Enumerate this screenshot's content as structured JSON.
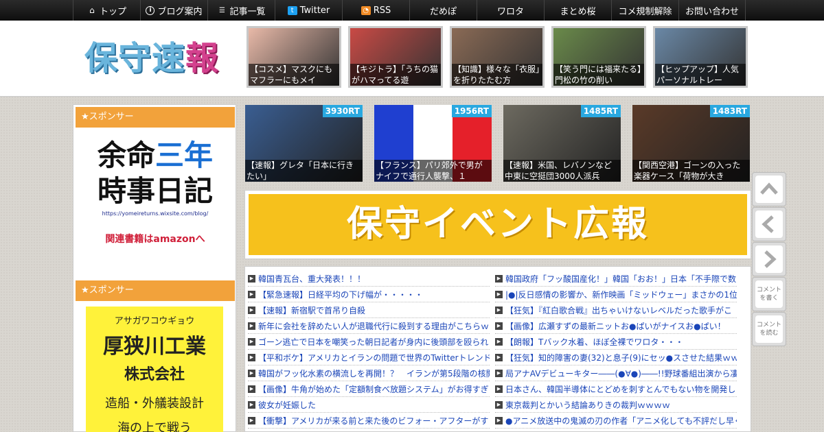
{
  "nav": {
    "items": [
      {
        "label": "トップ",
        "icon": "home-icon"
      },
      {
        "label": "ブログ案内",
        "icon": "info-icon"
      },
      {
        "label": "記事一覧",
        "icon": "list-icon"
      },
      {
        "label": "Twitter",
        "icon": "twitter-icon"
      },
      {
        "label": "RSS",
        "icon": "rss-icon"
      },
      {
        "label": "だめぽ",
        "icon": ""
      },
      {
        "label": "ワロタ",
        "icon": ""
      },
      {
        "label": "まとめ桜",
        "icon": ""
      },
      {
        "label": "コメ規制解除",
        "icon": ""
      },
      {
        "label": "お問い合わせ",
        "icon": ""
      }
    ]
  },
  "header": {
    "logo_part1": "保守",
    "logo_part2": "速",
    "logo_part3": "報",
    "thumbs": [
      {
        "caption": "【コスメ】マスクにもマフラーにもメイ",
        "color": "#e8b9a8"
      },
      {
        "caption": "【キジトラ】「うちの猫がハマってる遊",
        "color": "#c94a45"
      },
      {
        "caption": "【知識】様々な「衣服」を折りたたむ方",
        "color": "#8a6a55"
      },
      {
        "caption": "【笑う門には福来たる】門松の竹の削い",
        "color": "#6a8a4a"
      },
      {
        "caption": "【ヒップアップ】人気パーソナルトレー",
        "color": "#6a88a6"
      }
    ]
  },
  "sidebar": {
    "sponsor1_heading": "★スポンサー",
    "sponsor1_line1a": "余命",
    "sponsor1_line1b": "三年",
    "sponsor1_line2": "時事日記",
    "sponsor1_url": "https://yomeireturns.wixsite.com/blog/",
    "sponsor1_link": "関連書籍はamazonへ",
    "sponsor2_heading": "★スポンサー",
    "sponsor2_kana": "アサガワコウギョウ",
    "sponsor2_name": "厚狭川工業",
    "sponsor2_corp": "株式会社",
    "sponsor2_desc": "造船・外艤装設計",
    "sponsor2_more": "海の上で戦う"
  },
  "rt_row": [
    {
      "count": "3930RT",
      "caption": "【速報】グレタ「日本に行きたい」",
      "color": "#3a5e92"
    },
    {
      "count": "1956RT",
      "caption": "【フランス】パリ郊外で男がナイフで通行人襲撃、１",
      "color": "flag"
    },
    {
      "count": "1485RT",
      "caption": "【速報】米国、レバノンなど中東に空挺団3000人派兵",
      "color": "#6d6a60"
    },
    {
      "count": "1483RT",
      "caption": "【関西空港】ゴーンの入った楽器ケース「荷物が大き",
      "color": "#5a3a28"
    }
  ],
  "banner": {
    "text": "保守イベント広報"
  },
  "news_left": [
    "韓国青瓦台、重大発表！！！",
    "【緊急速報】日経平均の下げ幅が・・・・・",
    "【速報】新宿駅で首吊り自殺",
    "新年に会社を辞めたい人が退職代行に殺到する理由がこちらｗ",
    "ゴーン逃亡で日本を嘲笑った朝日記者が身内に後頭部を殴られ",
    "【平和ボケ】アメリカとイランの問題で世界のTwitterトレンド",
    "韓国がフッ化水素の横流しを再開！？　イランが第5段階の核開",
    "【画像】牛角が始めた「定額制食べ放題システム」がお得すぎ",
    "彼女が妊娠した",
    "【衝撃】アメリカが来る前と来た後のビフォー・アフターがす"
  ],
  "news_right": [
    "韓国政府「フッ酸国産化！」韓国「おお！」日本「不手際で数",
    "|●|反日感情の影響か、新作映画「ミッドウェー」まさかの1位",
    "【狂気】『紅白歌合戦』出ちゃいけないレベルだった歌手がこ",
    "【画像】広瀬すずの最新ニットお●ぱいがナイスお●ぱい！",
    "【朗報】Tバック水着、ほぼ全裸でワロタ・・・",
    "【狂気】知的障害の妻(32)と息子(9)にセッ●スさせた結果ｗｗｗ",
    "局アナAVデビューキター――(●∀●)――!!野球番組出演から凄まじ",
    "日本さん、韓国半導体にとどめを刺すとんでもない物を開発し",
    "東京裁判とかいう結論ありきの裁判ｗｗｗｗ",
    "●アニメ放送中の鬼滅の刃の作者「アニメ化しても不評だし早く"
  ],
  "side_buttons": {
    "comment_write": "コメントを書く",
    "comment_read": "コメントを読む"
  }
}
